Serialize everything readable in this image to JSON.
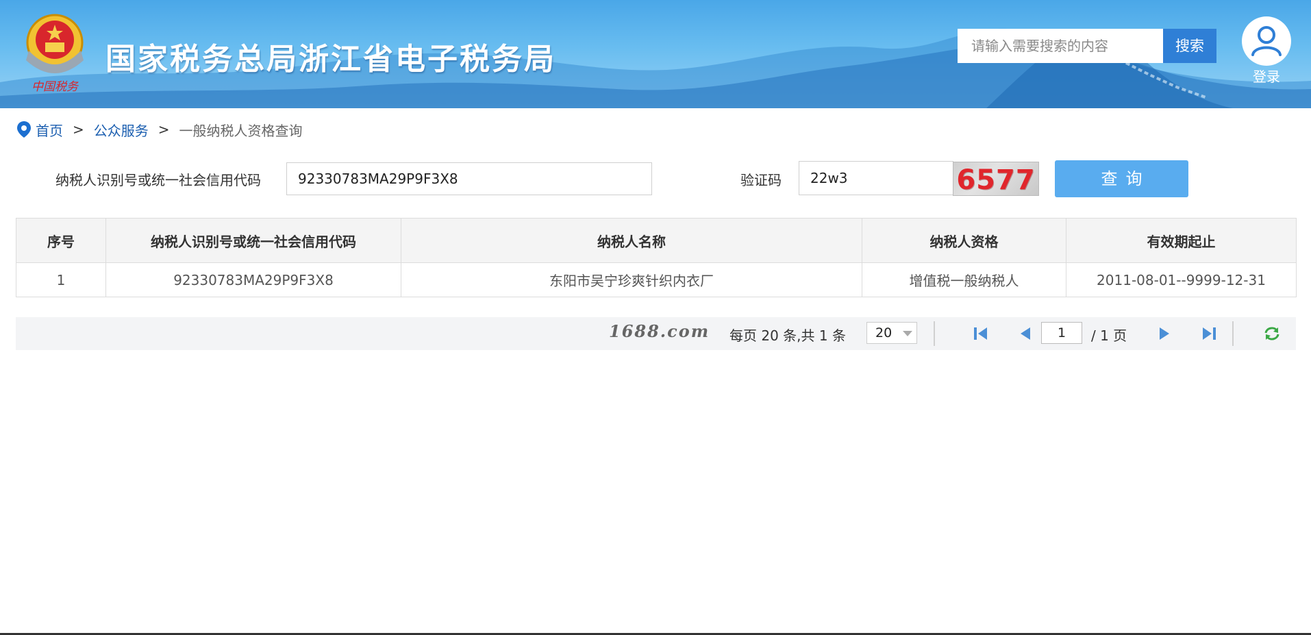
{
  "header": {
    "title": "国家税务总局浙江省电子税务局",
    "emblem_caption": "中国税务",
    "search": {
      "placeholder": "请输入需要搜索的内容",
      "button_label": "搜索"
    },
    "login_label": "登录"
  },
  "breadcrumb": {
    "home": "首页",
    "separator": ">",
    "section": "公众服务",
    "current": "一般纳税人资格查询"
  },
  "form": {
    "taxpayer_id_label": "纳税人识别号或统一社会信用代码",
    "taxpayer_id_value": "92330783MA29P9F3X8",
    "captcha_label": "验证码",
    "captcha_value": "22w3",
    "captcha_image_text": "6577",
    "query_button_label": "查询"
  },
  "table": {
    "columns": [
      "序号",
      "纳税人识别号或统一社会信用代码",
      "纳税人名称",
      "纳税人资格",
      "有效期起止"
    ],
    "rows": [
      [
        "1",
        "92330783MA29P9F3X8",
        "东阳市吴宁珍爽针织内衣厂",
        "增值税一般纳税人",
        "2011-08-01--9999-12-31"
      ]
    ]
  },
  "pagination": {
    "watermark": "1688.com",
    "summary": "每页 20 条,共 1 条",
    "page_size": "20",
    "current_page": "1",
    "total_pages_label": "/ 1 页"
  },
  "colors": {
    "header_blue": "#4aa7e8",
    "search_button": "#2f7fd6",
    "query_button": "#59acef",
    "link": "#1c5fb0",
    "captcha_text": "#e0262c",
    "refresh_green": "#3aa845"
  }
}
